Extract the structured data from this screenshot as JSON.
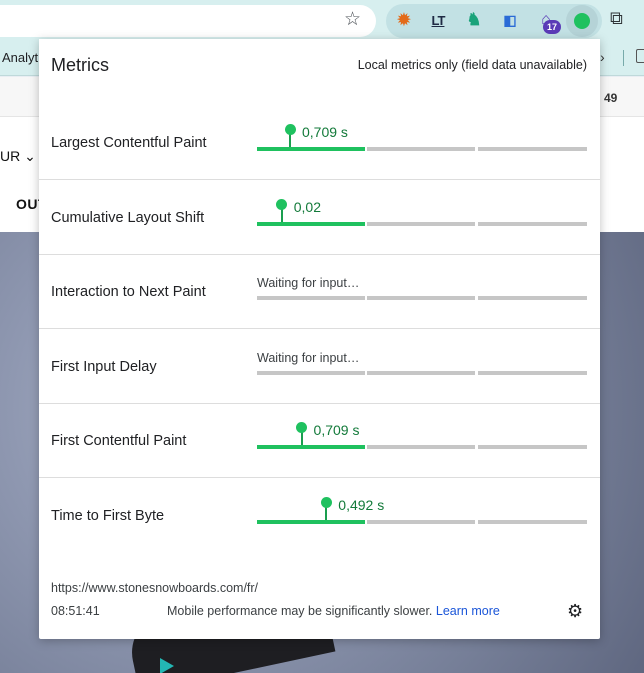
{
  "browser": {
    "bookmark_partial": "Analyt",
    "badge_count": "17",
    "star_icon": "star-icon",
    "extensions": [
      "fox-icon",
      "lt-icon",
      "dino-icon",
      "tag-icon",
      "home-icon",
      "web-vitals-icon",
      "puzzle-icon"
    ]
  },
  "site": {
    "currency_partial": "UR",
    "nav_partial": "OUT",
    "cart_count": "49"
  },
  "popup": {
    "title": "Metrics",
    "note": "Local metrics only (field data unavailable)",
    "metrics": [
      {
        "label": "Largest Contentful Paint",
        "value": "0,709 s",
        "status": "good",
        "position": 0.1
      },
      {
        "label": "Cumulative Layout Shift",
        "value": "0,02",
        "status": "good",
        "position": 0.075
      },
      {
        "label": "Interaction to Next Paint",
        "value": "Waiting for input…",
        "status": "waiting"
      },
      {
        "label": "First Input Delay",
        "value": "Waiting for input…",
        "status": "waiting"
      },
      {
        "label": "First Contentful Paint",
        "value": "0,709 s",
        "status": "good",
        "position": 0.135
      },
      {
        "label": "Time to First Byte",
        "value": "0,492 s",
        "status": "good",
        "position": 0.21
      }
    ],
    "footer": {
      "url": "https://www.stonesnowboards.com/fr/",
      "time": "08:51:41",
      "message": "Mobile performance may be significantly slower.",
      "link": "Learn more"
    }
  },
  "colors": {
    "good": "#1fc15f",
    "neutral": "#c6c6c6",
    "link": "#1a55d8"
  }
}
